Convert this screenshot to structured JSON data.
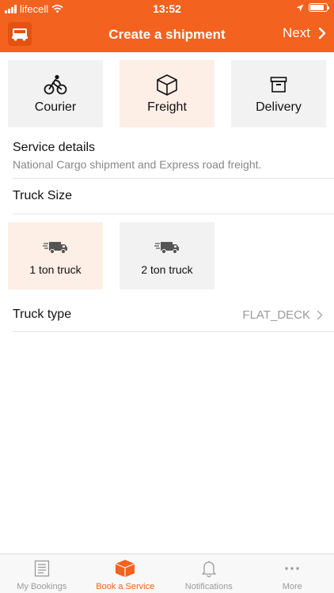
{
  "status_bar": {
    "carrier": "lifecell",
    "time": "13:52",
    "battery_level": 0.85
  },
  "nav": {
    "title": "Create a shipment",
    "next_label": "Next"
  },
  "service_tabs": [
    {
      "label": "Courier",
      "icon": "cyclist-icon",
      "selected": false
    },
    {
      "label": "Freight",
      "icon": "box-icon",
      "selected": true
    },
    {
      "label": "Delivery",
      "icon": "archive-icon",
      "selected": false
    }
  ],
  "service_details": {
    "title": "Service details",
    "subtitle": "National Cargo shipment and Express road freight."
  },
  "truck_size": {
    "label": "Truck Size",
    "options": [
      {
        "label": "1 ton truck",
        "icon": "truck-icon",
        "selected": true
      },
      {
        "label": "2 ton truck",
        "icon": "truck-icon",
        "selected": false
      }
    ]
  },
  "truck_type": {
    "label": "Truck type",
    "value": "FLAT_DECK"
  },
  "tab_bar": [
    {
      "label": "My Bookings",
      "icon": "document-icon",
      "active": false
    },
    {
      "label": "Book a Service",
      "icon": "package-icon",
      "active": true
    },
    {
      "label": "Notifications",
      "icon": "bell-icon",
      "active": false
    },
    {
      "label": "More",
      "icon": "more-icon",
      "active": false
    }
  ],
  "colors": {
    "accent": "#f4621f",
    "selected_tile": "#fdeee6",
    "tile": "#f2f2f2",
    "muted_text": "#888888"
  }
}
